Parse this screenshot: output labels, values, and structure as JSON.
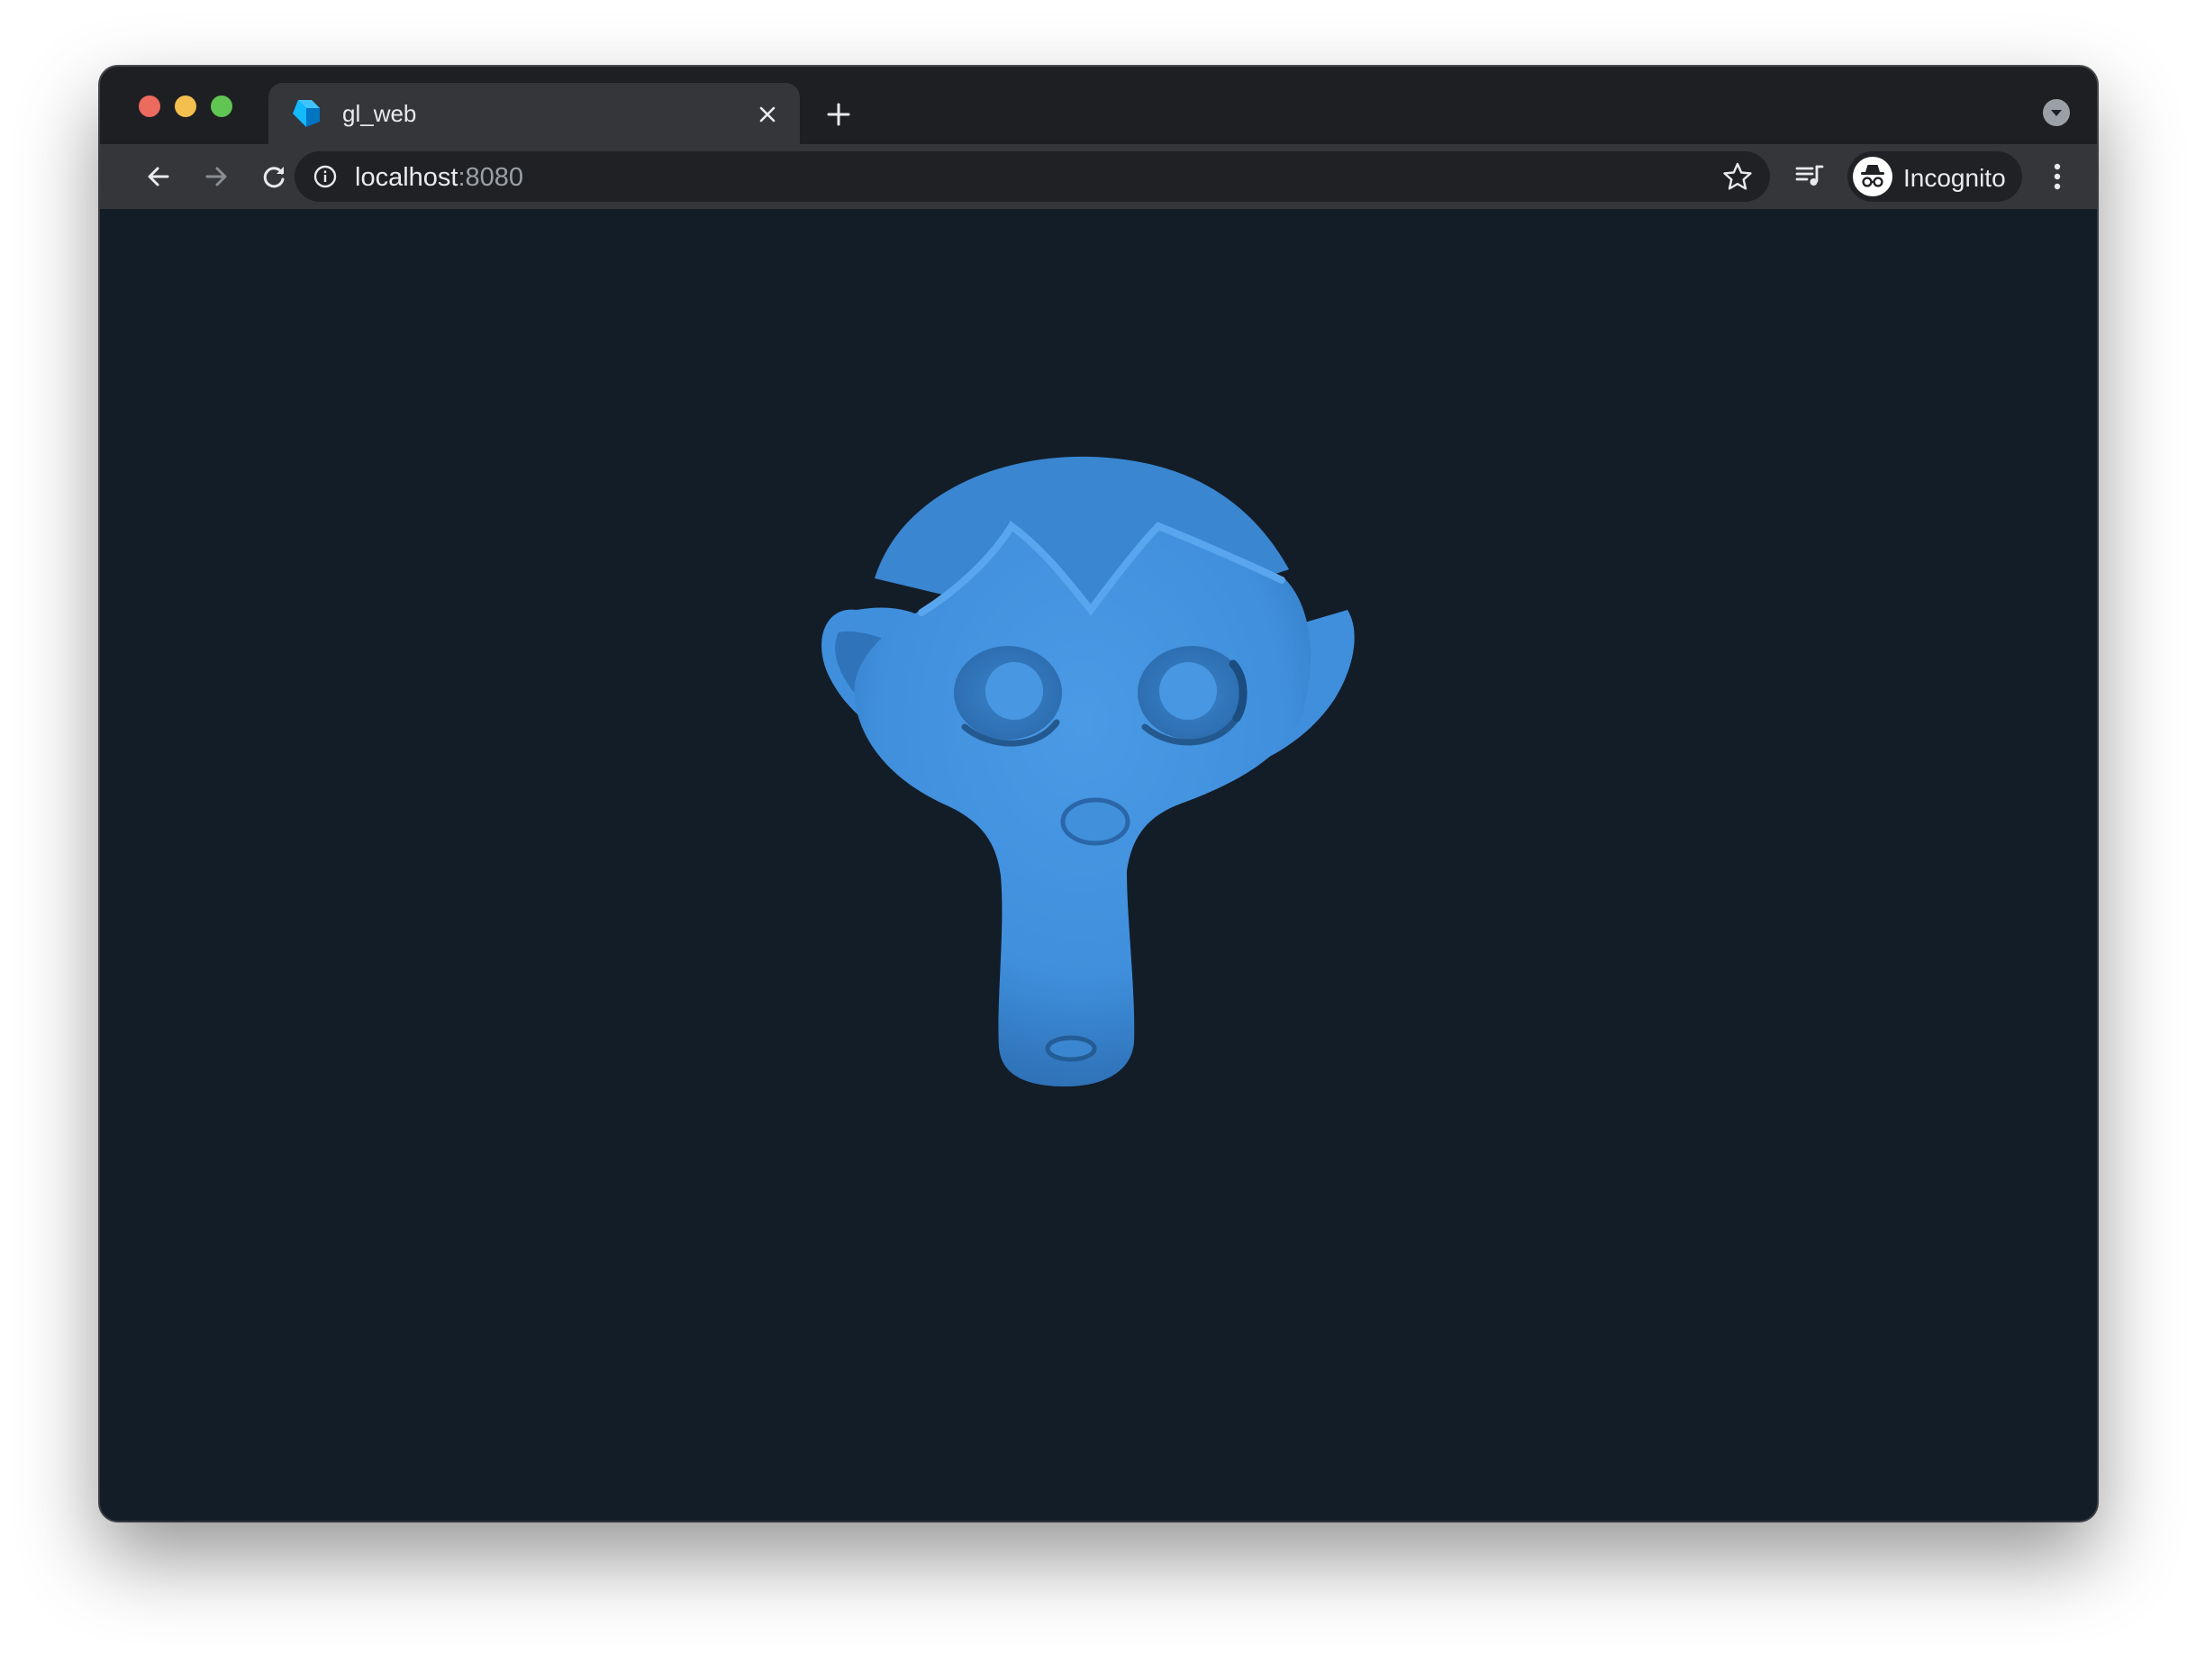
{
  "window": {
    "traffic_lights": [
      "close",
      "minimize",
      "zoom"
    ]
  },
  "tab": {
    "title": "gl_web",
    "favicon": "dart-logo-icon"
  },
  "toolbar": {
    "url_host": "localhost",
    "url_port": ":8080",
    "profile_label": "Incognito"
  },
  "icons": {
    "back": "arrow-left-icon",
    "forward": "arrow-right-icon",
    "reload": "reload-icon",
    "info": "info-icon",
    "bookmark": "star-icon",
    "media": "media-queue-icon",
    "incognito": "incognito-icon",
    "menu": "kebab-menu-icon",
    "tab_search": "chevron-down-icon"
  },
  "colors": {
    "viewport_background": "#131d28",
    "model_color": "#3f8fdc",
    "chrome_dark": "#1e1f22",
    "toolbar": "#35363a"
  },
  "scene": {
    "model": "suzanne-monkey-head"
  }
}
